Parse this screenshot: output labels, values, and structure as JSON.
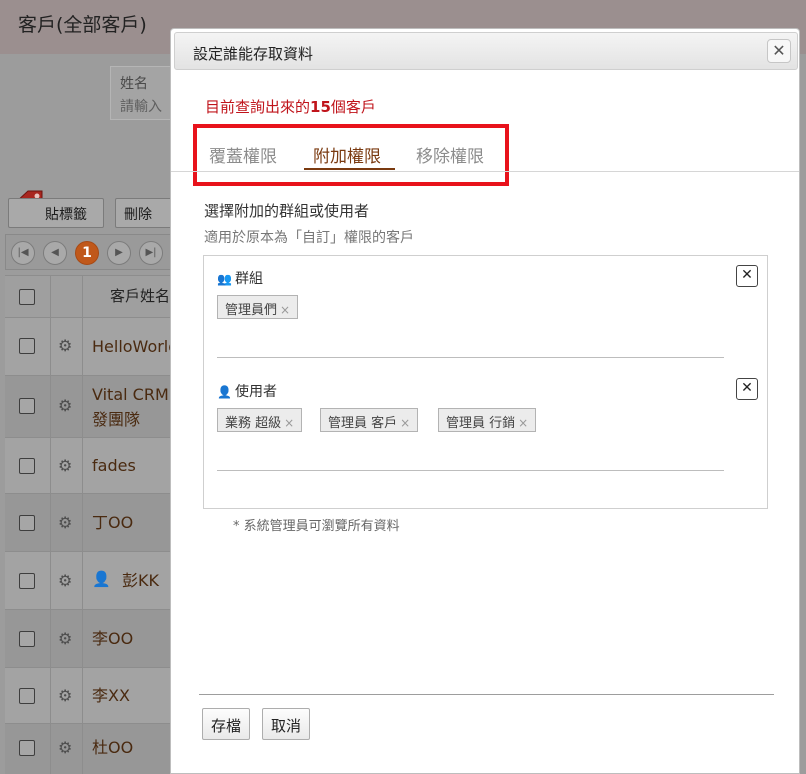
{
  "background": {
    "page_title": "客戶(全部客戶)",
    "search": {
      "label": "姓名",
      "placeholder": "請輸入"
    },
    "toolbar": {
      "tag_button": "貼標籤",
      "delete_button": "刪除"
    },
    "pager": {
      "current_page": "1"
    },
    "grid": {
      "column_header": "客戶姓名",
      "rows": [
        {
          "name": "HelloWorld"
        },
        {
          "name": "Vital CRM\n發團隊"
        },
        {
          "name": "fades"
        },
        {
          "name": "丁OO"
        },
        {
          "name": "彭KK"
        },
        {
          "name": "李OO"
        },
        {
          "name": "李XX"
        },
        {
          "name": "杜OO"
        }
      ]
    }
  },
  "modal": {
    "title": "設定誰能存取資料",
    "count_prefix": "目前查詢出來的",
    "count_number": "15",
    "count_suffix": "個客戶",
    "tabs": [
      {
        "label": "覆蓋權限",
        "active": false
      },
      {
        "label": "附加權限",
        "active": true
      },
      {
        "label": "移除權限",
        "active": false
      }
    ],
    "section_title": "選擇附加的群組或使用者",
    "section_subtitle": "適用於原本為「自訂」權限的客戶",
    "groups": {
      "label": "群組",
      "icon": "users-icon",
      "chips": [
        "管理員們"
      ]
    },
    "users": {
      "label": "使用者",
      "icon": "user-icon",
      "chips": [
        "業務 超級",
        "管理員 客戶",
        "管理員 行銷"
      ]
    },
    "note": "*  系統管理員可瀏覽所有資料",
    "buttons": {
      "save": "存檔",
      "cancel": "取消"
    }
  },
  "colors": {
    "accent_red": "#c0141b",
    "highlight_box": "#e8121b",
    "active_tab": "#7a3a10",
    "pager_active": "#c0581a"
  }
}
